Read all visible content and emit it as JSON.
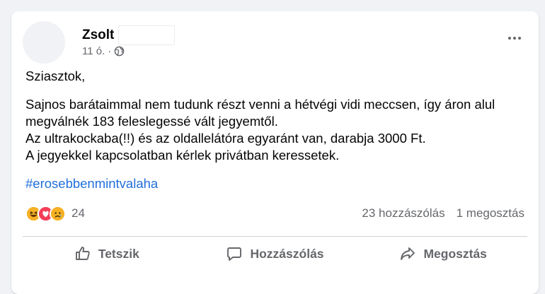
{
  "post": {
    "author": "Zsolt",
    "time": "11 ó.",
    "separator": "·",
    "paragraphs": [
      "Sziasztok,",
      "Sajnos barátaimmal nem tudunk részt venni a hétvégi vidi meccsen, így áron alul megválnék 183 feleslegessé vált jegyemtől.",
      "Az ultrakockaba(!!) és az oldallelátóra egyaránt van, darabja 3000 Ft.",
      "A jegyekkel kapcsolatban kérlek privátban keressetek."
    ],
    "hashtag": "#erosebbenmintvalaha"
  },
  "stats": {
    "reaction_count": "24",
    "reactions": [
      "laughing-emoji",
      "love-heart",
      "sad-emoji"
    ],
    "comments": "23 hozzászólás",
    "shares": "1 megosztás"
  },
  "actions": {
    "like": "Tetszik",
    "comment": "Hozzászólás",
    "share": "Megosztás"
  },
  "colors": {
    "link": "#216fdb",
    "secondary_text": "#65676b",
    "love": "#f33e58",
    "reaction_yellow": "#f7b125"
  }
}
